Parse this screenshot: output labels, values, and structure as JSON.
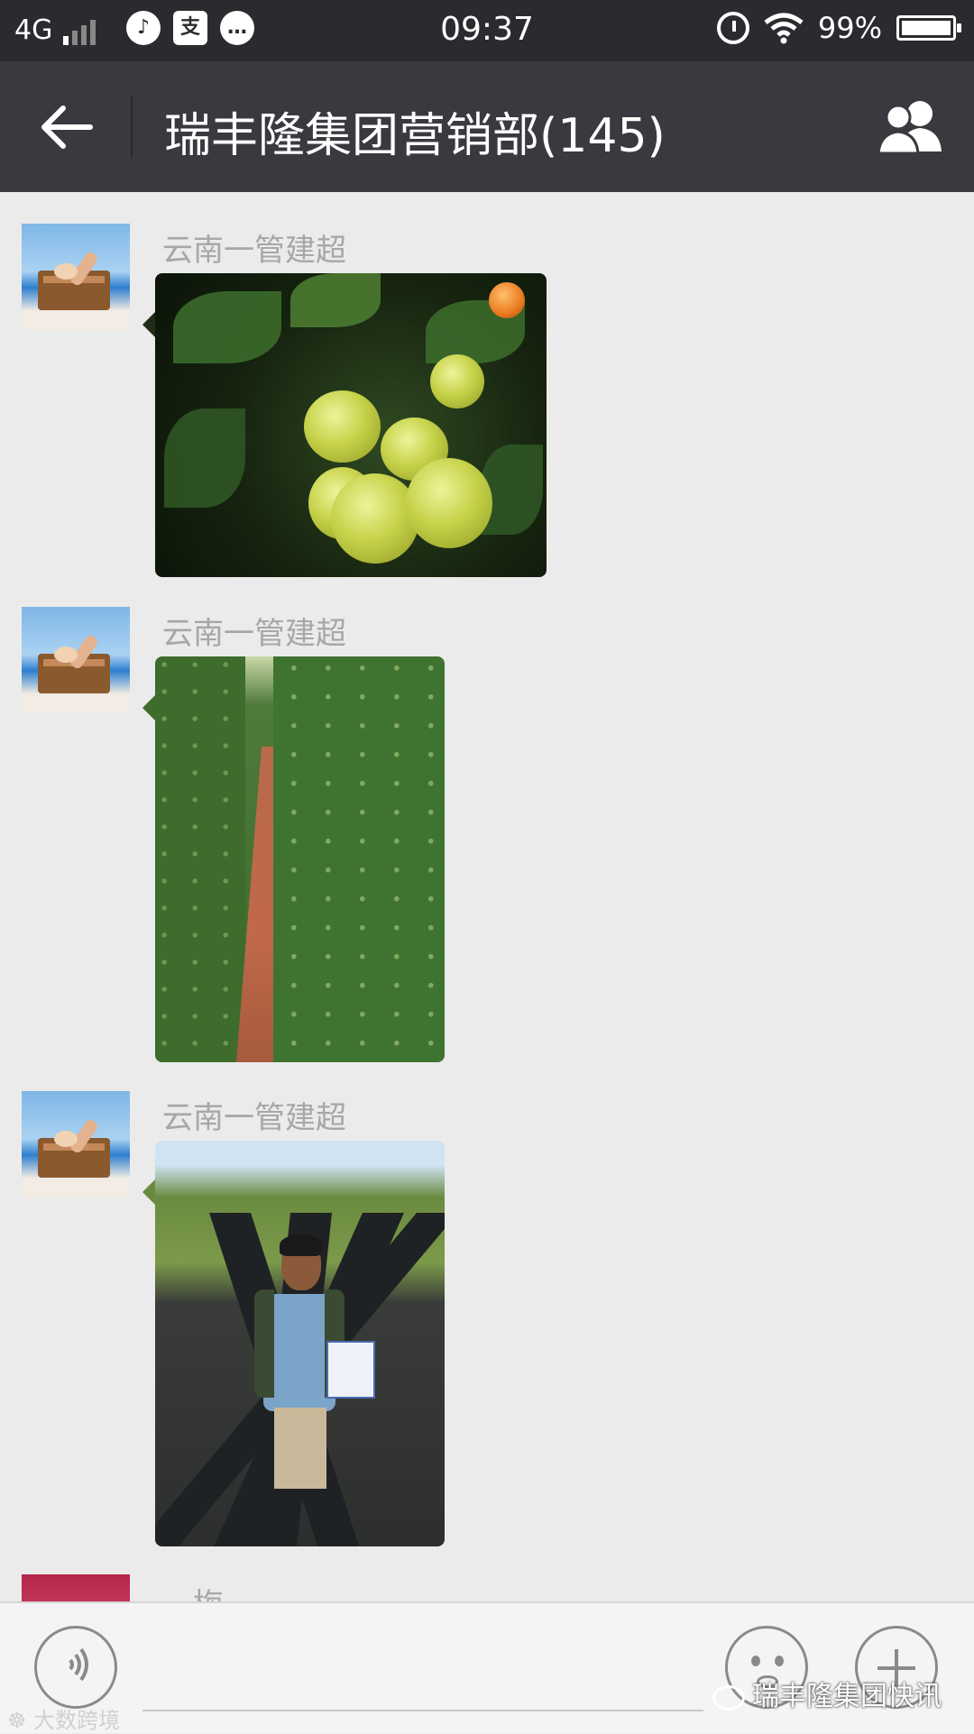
{
  "status_bar": {
    "network": "4G",
    "time": "09:37",
    "battery_percent": "99%",
    "app_icon_2": "支"
  },
  "navbar": {
    "title": "瑞丰隆集团营销部(145)"
  },
  "messages": [
    {
      "sender": "云南一管建超",
      "content_type": "photo",
      "photo": "green-tomatoes"
    },
    {
      "sender": "云南一管建超",
      "content_type": "photo",
      "photo": "tomato-rows"
    },
    {
      "sender": "云南一管建超",
      "content_type": "photo",
      "photo": "farmer-in-field"
    },
    {
      "sender": "一梅"
    }
  ],
  "watermarks": {
    "left": "大数跨境",
    "right": "瑞丰隆集团快讯"
  },
  "colors": {
    "status_bar_bg": "#2b2b2f",
    "navbar_bg": "#393a3f",
    "chat_bg": "#ebebeb",
    "sender_text": "#a7a7a7"
  }
}
